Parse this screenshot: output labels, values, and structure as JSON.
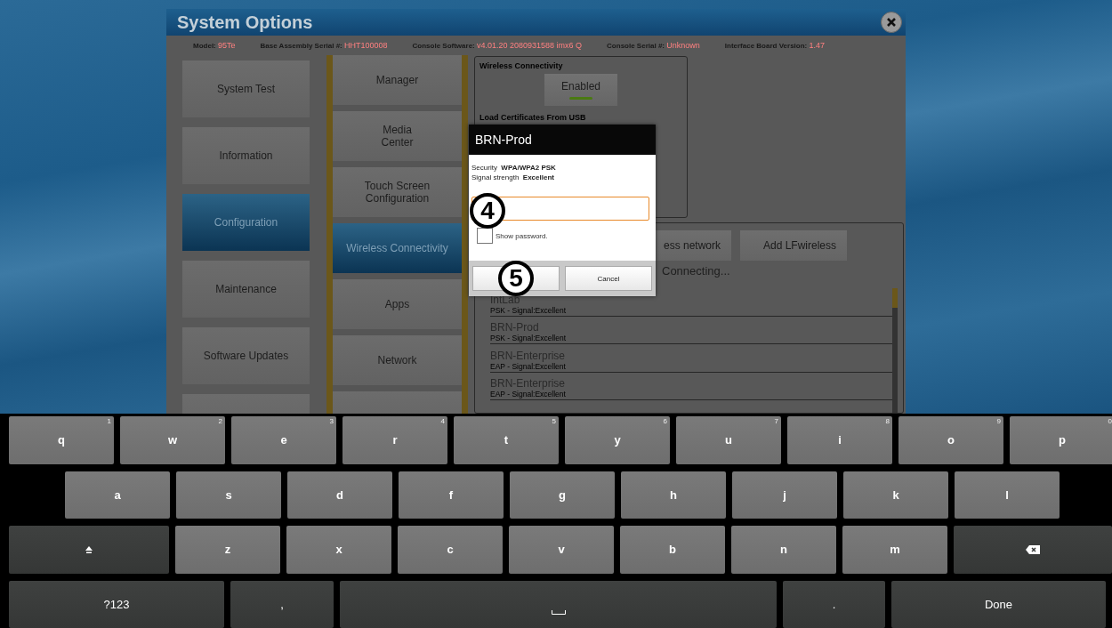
{
  "window": {
    "title": "System Options"
  },
  "info": [
    {
      "label": "Model:",
      "value": "95Te"
    },
    {
      "label": "Base Assembly Serial #:",
      "value": "HHT100008"
    },
    {
      "label": "Console Software:",
      "value": "v4.01.20 2080931588 imx6 Q"
    },
    {
      "label": "Console Serial #:",
      "value": "Unknown"
    },
    {
      "label": "Interface Board Version:",
      "value": "1.47"
    }
  ],
  "menu": [
    {
      "label": "System Test",
      "selected": false
    },
    {
      "label": "Information",
      "selected": false
    },
    {
      "label": "Configuration",
      "selected": true
    },
    {
      "label": "Maintenance",
      "selected": false
    },
    {
      "label": "Software Updates",
      "selected": false
    },
    {
      "selected": false
    }
  ],
  "submenu": [
    {
      "label": "Manager",
      "selected": false
    },
    {
      "label": "Media\nCenter",
      "selected": false
    },
    {
      "label": "Touch Screen\nConfiguration",
      "selected": false
    },
    {
      "label": "Wireless Connectivity",
      "selected": true
    },
    {
      "label": "Apps",
      "selected": false
    },
    {
      "label": "Network",
      "selected": false
    },
    {
      "selected": false
    }
  ],
  "wireless": {
    "heading": "Wireless Connectivity",
    "toggle": {
      "label": "Enabled",
      "on": true
    },
    "certificates_heading": "Load Certificates From USB"
  },
  "network_buttons": [
    "ess network",
    "Add LFwireless"
  ],
  "status": "Connecting...",
  "networks": [
    {
      "name": "IntLab",
      "detail": "PSK - Signal:Excellent"
    },
    {
      "name": "BRN-Prod",
      "detail": "PSK - Signal:Excellent"
    },
    {
      "name": "BRN-Enterprise",
      "detail": "EAP - Signal:Excellent"
    },
    {
      "name": "BRN-Enterprise",
      "detail": "EAP - Signal:Excellent"
    }
  ],
  "dialog": {
    "title": "BRN-Prod",
    "security_label": "Security",
    "security": "WPA/WPA2 PSK",
    "signal_label": "Signal strength",
    "signal": "Excellent",
    "show_password": {
      "label": "Show password.",
      "checked": false
    },
    "cancel": "Cancel"
  },
  "annotations": [
    "4",
    "5"
  ],
  "keyboard": [
    [
      {
        "kind": "letter",
        "label": "q",
        "hint": "1"
      },
      {
        "kind": "letter",
        "label": "w",
        "hint": "2"
      },
      {
        "kind": "letter",
        "label": "e",
        "hint": "3"
      },
      {
        "kind": "letter",
        "label": "r",
        "hint": "4"
      },
      {
        "kind": "letter",
        "label": "t",
        "hint": "5"
      },
      {
        "kind": "letter",
        "label": "y",
        "hint": "6"
      },
      {
        "kind": "letter",
        "label": "u",
        "hint": "7"
      },
      {
        "kind": "letter",
        "label": "i",
        "hint": "8"
      },
      {
        "kind": "letter",
        "label": "o",
        "hint": "9"
      },
      {
        "kind": "letter",
        "label": "p",
        "hint": "0"
      }
    ],
    [
      {
        "kind": "letter",
        "label": "a"
      },
      {
        "kind": "letter",
        "label": "s"
      },
      {
        "kind": "letter",
        "label": "d"
      },
      {
        "kind": "letter",
        "label": "f"
      },
      {
        "kind": "letter",
        "label": "g"
      },
      {
        "kind": "letter",
        "label": "h"
      },
      {
        "kind": "letter",
        "label": "j"
      },
      {
        "kind": "letter",
        "label": "k"
      },
      {
        "kind": "letter",
        "label": "l"
      }
    ],
    [
      {
        "kind": "shift"
      },
      {
        "kind": "letter",
        "label": "z"
      },
      {
        "kind": "letter",
        "label": "x"
      },
      {
        "kind": "letter",
        "label": "c"
      },
      {
        "kind": "letter",
        "label": "v"
      },
      {
        "kind": "letter",
        "label": "b"
      },
      {
        "kind": "letter",
        "label": "n"
      },
      {
        "kind": "letter",
        "label": "m"
      },
      {
        "kind": "backspace"
      }
    ],
    [
      {
        "kind": "symbols",
        "label": "?123"
      },
      {
        "kind": "punct",
        "label": ","
      },
      {
        "kind": "space"
      },
      {
        "kind": "punct",
        "label": "."
      },
      {
        "kind": "done",
        "label": "Done"
      }
    ]
  ]
}
